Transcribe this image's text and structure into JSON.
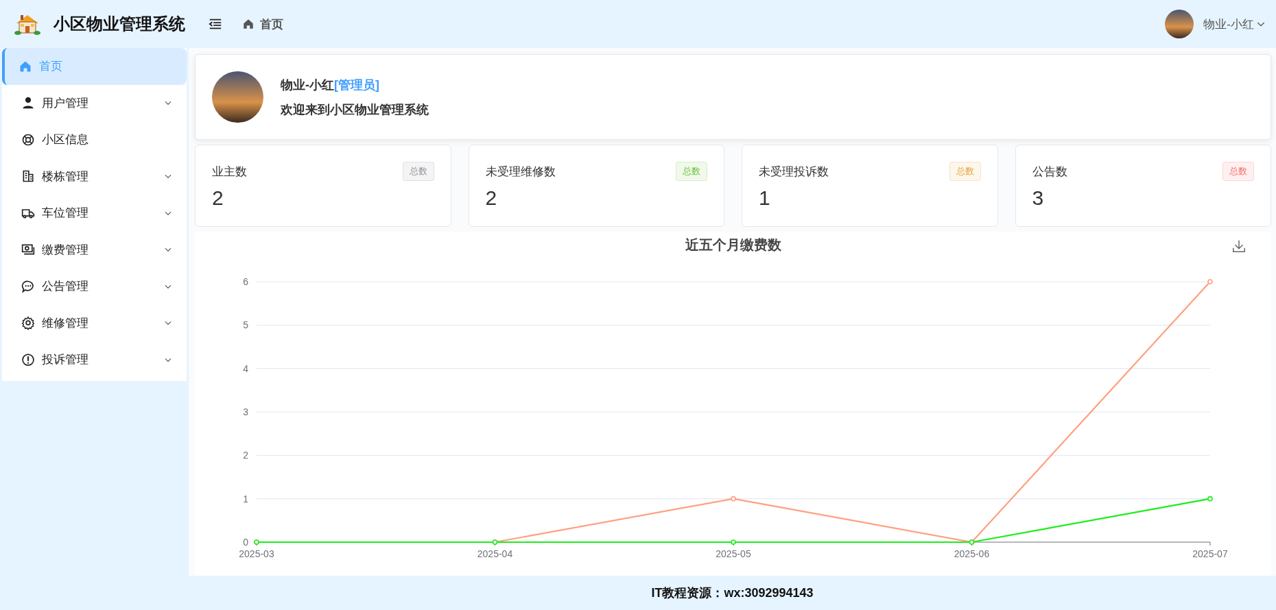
{
  "header": {
    "title": "小区物业管理系统",
    "breadcrumb": "首页",
    "user": "物业-小红"
  },
  "sidebar": {
    "items": [
      {
        "label": "首页",
        "selected": true,
        "has_submenu": false
      },
      {
        "label": "用户管理",
        "selected": false,
        "has_submenu": true
      },
      {
        "label": "小区信息",
        "selected": false,
        "has_submenu": false
      },
      {
        "label": "楼栋管理",
        "selected": false,
        "has_submenu": true
      },
      {
        "label": "车位管理",
        "selected": false,
        "has_submenu": true
      },
      {
        "label": "缴费管理",
        "selected": false,
        "has_submenu": true
      },
      {
        "label": "公告管理",
        "selected": false,
        "has_submenu": true
      },
      {
        "label": "维修管理",
        "selected": false,
        "has_submenu": true
      },
      {
        "label": "投诉管理",
        "selected": false,
        "has_submenu": true
      }
    ]
  },
  "welcome": {
    "name": "物业-小红",
    "role": "[管理员]",
    "message": "欢迎来到小区物业管理系统"
  },
  "stats": [
    {
      "label": "业主数",
      "value": "2",
      "badge": "总数",
      "color": "#909399"
    },
    {
      "label": "未受理维修数",
      "value": "2",
      "badge": "总数",
      "color": "#67c23a"
    },
    {
      "label": "未受理投诉数",
      "value": "1",
      "badge": "总数",
      "color": "#e6a23c"
    },
    {
      "label": "公告数",
      "value": "3",
      "badge": "总数",
      "color": "#f56c6c"
    }
  ],
  "chart": {
    "chart_data": {
      "type": "line",
      "title": "近五个月缴费数",
      "categories": [
        "2025-03",
        "2025-04",
        "2025-05",
        "2025-06",
        "2025-07"
      ],
      "ylim": [
        0,
        6
      ],
      "grid": true,
      "yticks": [
        0,
        1,
        2,
        3,
        4,
        5,
        6
      ],
      "series": [
        {
          "color": "#ff9f7f",
          "marker": true,
          "values": [
            0,
            0,
            1,
            0,
            6
          ]
        },
        {
          "color": "#1aee1a",
          "marker": true,
          "values": [
            0,
            0,
            0,
            0,
            1
          ]
        }
      ]
    }
  },
  "footer": {
    "text": "IT教程资源：wx:3092994143"
  }
}
